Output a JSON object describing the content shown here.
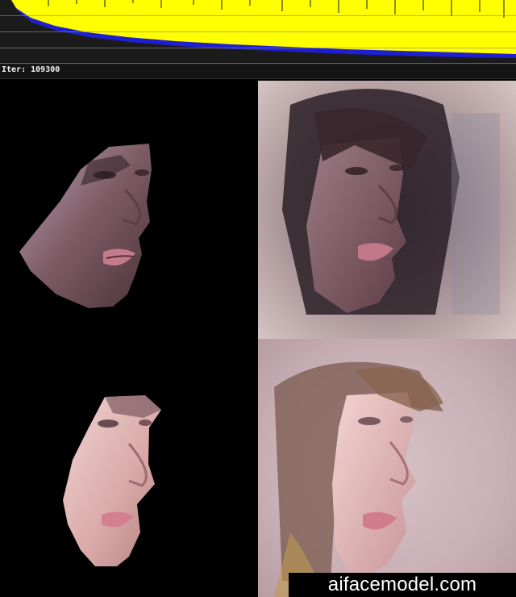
{
  "status": {
    "iter_label": "Iter:",
    "iter_value": "109300"
  },
  "watermark": {
    "text": "aifacemodel.com"
  },
  "colors": {
    "loss_series_1": "#ffff00",
    "loss_series_2": "#1f1fd0",
    "graph_background": "#1b1b1b",
    "preview_background": "#000000"
  },
  "previews": {
    "rows": 2,
    "columns": [
      "source-masked-face",
      "model-output-face"
    ]
  }
}
